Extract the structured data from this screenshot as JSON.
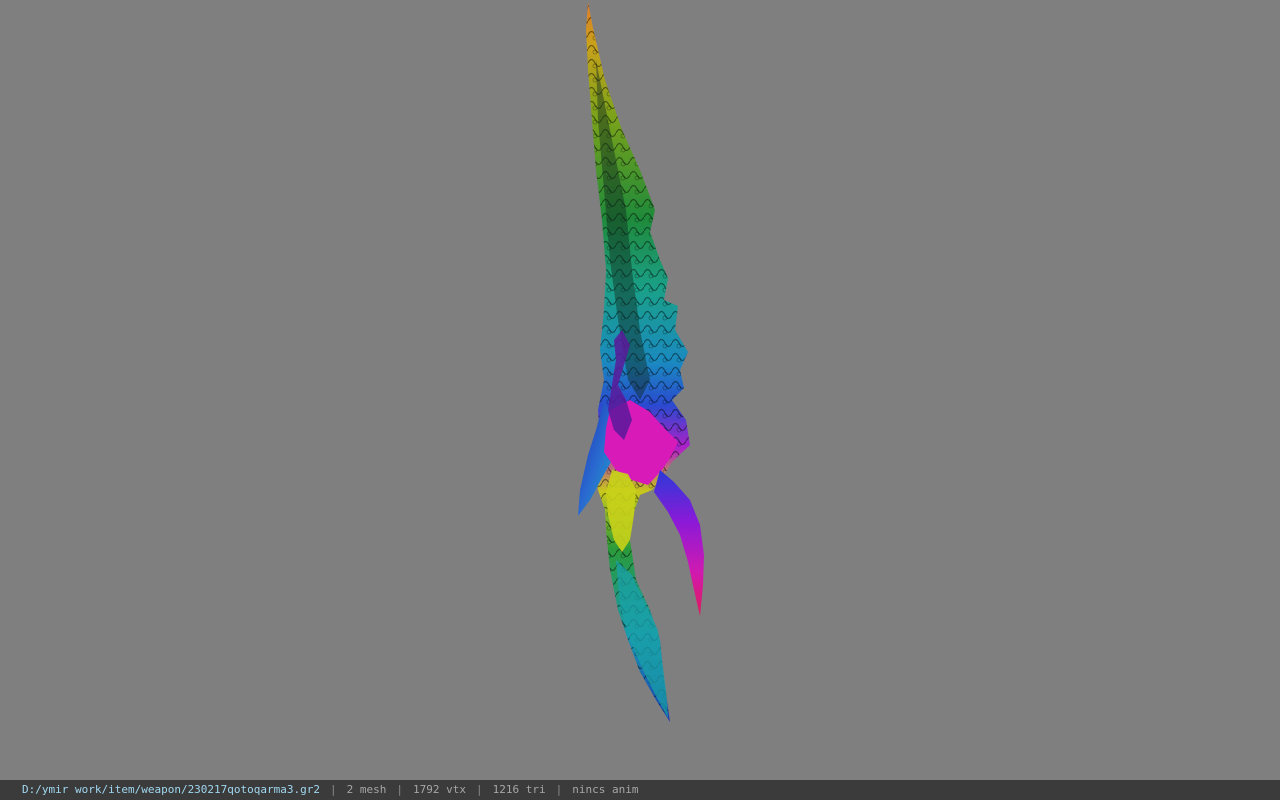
{
  "viewer": {
    "model_name": "weapon-model",
    "background_color": "#7f7f7f"
  },
  "status": {
    "path": "D:/ymir work/item/weapon/230217qotoqarma3.gr2",
    "sep": "|",
    "mesh": "2 mesh",
    "vtx": "1792 vtx",
    "tri": "1216 tri",
    "anim": "nincs anim"
  }
}
